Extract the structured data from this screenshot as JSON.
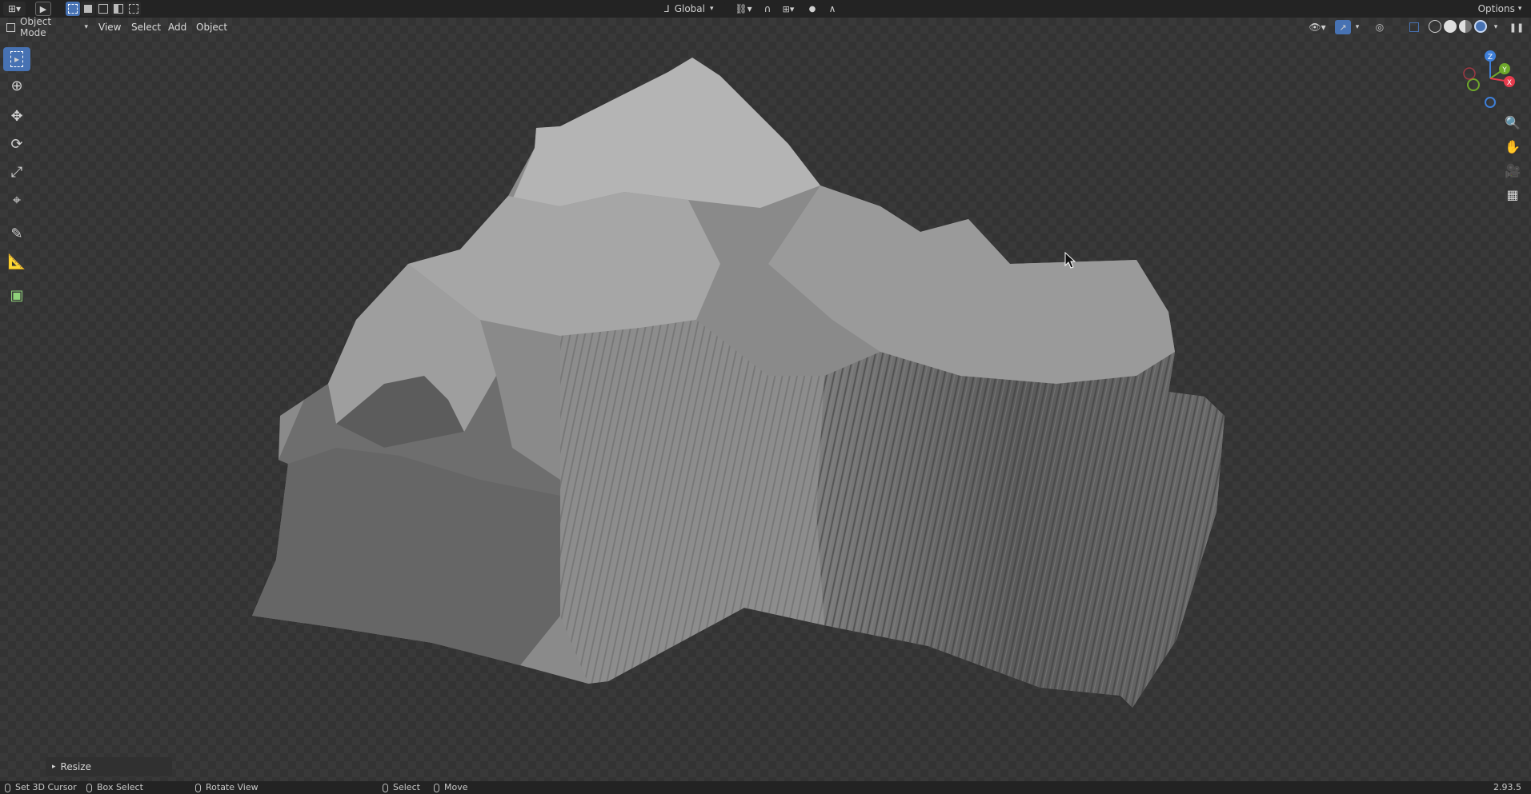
{
  "topbar": {
    "transform_orientation": "Global",
    "options_label": "Options"
  },
  "header": {
    "mode_label": "Object Mode",
    "menus": [
      "View",
      "Select",
      "Add",
      "Object"
    ]
  },
  "toolbar": {
    "tools": [
      {
        "name": "select-box-tool",
        "icon": "cursor-box-icon",
        "active": true
      },
      {
        "name": "cursor-tool",
        "icon": "3d-cursor-icon"
      },
      {
        "name": "move-tool",
        "icon": "move-arrows-icon"
      },
      {
        "name": "rotate-tool",
        "icon": "rotate-icon"
      },
      {
        "name": "scale-tool",
        "icon": "scale-icon"
      },
      {
        "name": "transform-tool",
        "icon": "transform-icon"
      },
      {
        "name": "annotate-tool",
        "icon": "pencil-icon"
      },
      {
        "name": "measure-tool",
        "icon": "ruler-icon"
      },
      {
        "name": "add-cube-tool",
        "icon": "cube-icon"
      }
    ]
  },
  "gizmo": {
    "z_label": "Z",
    "y_label": "Y",
    "x_label": "X"
  },
  "operator_panel": {
    "label": "Resize"
  },
  "statusbar": {
    "set_cursor": "Set 3D Cursor",
    "box_select": "Box Select",
    "rotate_view": "Rotate View",
    "select": "Select",
    "move": "Move",
    "version": "2.93.5"
  },
  "colors": {
    "accent": "#4772b3",
    "viewport_bg": "#393939",
    "header_bg": "#232323",
    "axis_x": "#e63b4d",
    "axis_y": "#6fa82b",
    "axis_z": "#3f7fd8"
  }
}
